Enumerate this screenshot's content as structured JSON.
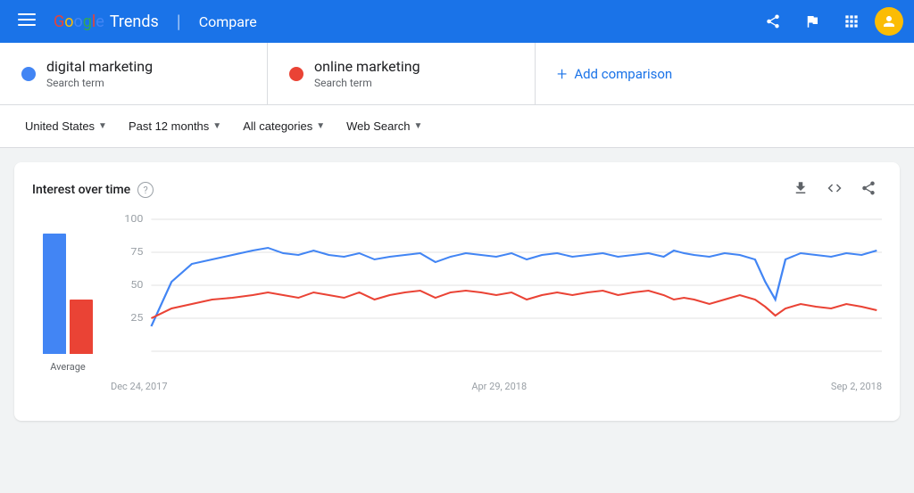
{
  "header": {
    "menu_icon": "☰",
    "logo_google": "Google",
    "logo_trends": "Trends",
    "divider": "|",
    "page_title": "Compare",
    "icons": {
      "share": "share",
      "flag": "flag",
      "apps": "apps",
      "avatar": "A"
    }
  },
  "search_terms": [
    {
      "id": "term1",
      "name": "digital marketing",
      "type": "Search term",
      "dot_color": "#4285f4"
    },
    {
      "id": "term2",
      "name": "online marketing",
      "type": "Search term",
      "dot_color": "#ea4335"
    }
  ],
  "add_comparison": {
    "label": "Add comparison",
    "icon": "+"
  },
  "filters": [
    {
      "id": "region",
      "label": "United States",
      "has_arrow": true
    },
    {
      "id": "time",
      "label": "Past 12 months",
      "has_arrow": true
    },
    {
      "id": "category",
      "label": "All categories",
      "has_arrow": true
    },
    {
      "id": "search_type",
      "label": "Web Search",
      "has_arrow": true
    }
  ],
  "chart": {
    "title": "Interest over time",
    "help_icon": "?",
    "actions": {
      "download": "⬇",
      "embed": "<>",
      "share": "share"
    },
    "y_axis_labels": [
      "100",
      "75",
      "50",
      "25"
    ],
    "x_axis_labels": [
      "Dec 24, 2017",
      "Apr 29, 2018",
      "Sep 2, 2018"
    ],
    "bar_chart": {
      "label": "Average",
      "bars": [
        {
          "color": "#4285f4",
          "height_pct": 82
        },
        {
          "color": "#ea4335",
          "height_pct": 37
        }
      ]
    }
  },
  "colors": {
    "blue": "#4285f4",
    "red": "#ea4335",
    "header_blue": "#1a73e8",
    "grid_line": "#e0e0e0",
    "axis_text": "#9aa0a6"
  }
}
